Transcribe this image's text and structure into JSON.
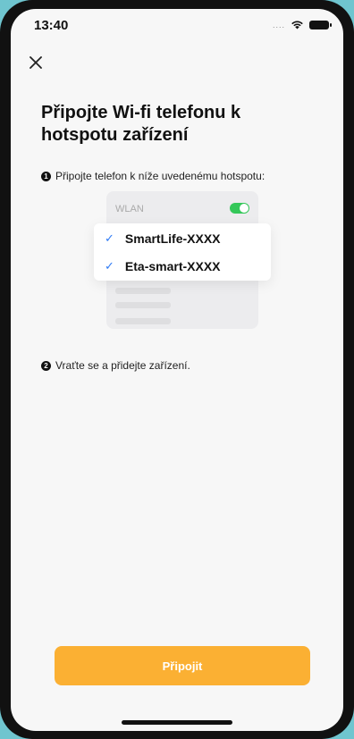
{
  "status_bar": {
    "time": "13:40",
    "signal": "....",
    "icons": [
      "wifi-icon",
      "battery-icon"
    ]
  },
  "header": {
    "close_icon": "close-icon"
  },
  "title": "Připojte Wi-fi telefonu k hotspotu zařízení",
  "steps": [
    {
      "number": "1",
      "text": "Připojte telefon k níže uvedenému hotspotu:"
    },
    {
      "number": "2",
      "text": "Vraťte se a přidejte zařízení."
    }
  ],
  "illustration": {
    "wlan_label": "WLAN",
    "toggle_on": true,
    "networks": [
      {
        "check": "✓",
        "name": "SmartLife-XXXX"
      },
      {
        "check": "✓",
        "name": "Eta-smart-XXXX"
      }
    ]
  },
  "connect_button": {
    "label": "Připojit"
  },
  "colors": {
    "accent": "#fbb033",
    "check": "#2f7bf5",
    "toggle": "#34c759",
    "background": "#f7f7f7"
  }
}
